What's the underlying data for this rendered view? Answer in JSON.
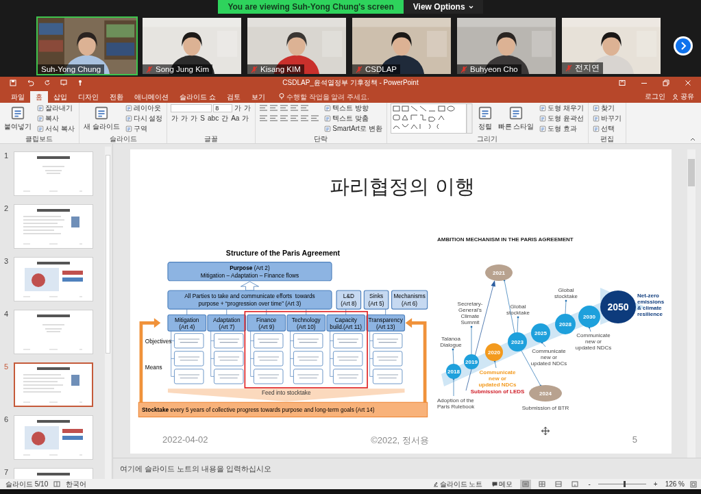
{
  "banner": {
    "text": "You are viewing Suh-Yong Chung's screen",
    "options": "View Options"
  },
  "participants": [
    {
      "name": "Suh-Yong Chung",
      "muted": false,
      "active": true
    },
    {
      "name": "Song Jung Kim",
      "muted": true,
      "active": false
    },
    {
      "name": "Kisang KIM",
      "muted": true,
      "active": false
    },
    {
      "name": "CSDLAP",
      "muted": true,
      "active": false
    },
    {
      "name": "Buhyeon Cho",
      "muted": true,
      "active": false
    },
    {
      "name": "전지연",
      "muted": true,
      "active": false
    }
  ],
  "window": {
    "title": "CSDLAP_윤석열정부 기후정책 - PowerPoint"
  },
  "tabs": [
    {
      "label": "파일",
      "selected": false
    },
    {
      "label": "홈",
      "selected": true
    },
    {
      "label": "삽입",
      "selected": false
    },
    {
      "label": "디자인",
      "selected": false
    },
    {
      "label": "전환",
      "selected": false
    },
    {
      "label": "애니메이션",
      "selected": false
    },
    {
      "label": "슬라이드 쇼",
      "selected": false
    },
    {
      "label": "검토",
      "selected": false
    },
    {
      "label": "보기",
      "selected": false
    }
  ],
  "tell_me": {
    "placeholder": "수행할 작업을 알려 주세요."
  },
  "account": {
    "login": "로그인",
    "share": "공유"
  },
  "ribbon": [
    {
      "label": "클립보드",
      "columns": [
        [
          [
            {
              "kind": "large",
              "label": "붙여넣기"
            }
          ]
        ],
        [
          [
            {
              "kind": "small",
              "label": "잘라내기"
            }
          ],
          [
            {
              "kind": "small",
              "label": "복사"
            }
          ],
          [
            {
              "kind": "small",
              "label": "서식 복사"
            }
          ]
        ]
      ]
    },
    {
      "label": "슬라이드",
      "columns": [
        [
          [
            {
              "kind": "large",
              "label": "새 슬라이드"
            }
          ]
        ],
        [
          [
            {
              "kind": "small",
              "label": "레이아웃"
            }
          ],
          [
            {
              "kind": "small",
              "label": "다시 설정"
            }
          ],
          [
            {
              "kind": "small",
              "label": "구역"
            }
          ]
        ]
      ]
    },
    {
      "label": "글꼴",
      "columns": [
        [
          [
            {
              "kind": "field"
            },
            {
              "kind": "field",
              "value": "8"
            },
            {
              "kind": "glyph",
              "label": "가"
            },
            {
              "kind": "glyph",
              "label": "가"
            }
          ],
          [
            {
              "kind": "glyph",
              "label": "가"
            },
            {
              "kind": "glyph",
              "label": "가"
            },
            {
              "kind": "glyph",
              "label": "가"
            },
            {
              "kind": "glyph",
              "label": "S"
            },
            {
              "kind": "glyph",
              "label": "abc"
            },
            {
              "kind": "glyph",
              "label": "간"
            },
            {
              "kind": "glyph",
              "label": "Aa"
            },
            {
              "kind": "glyph",
              "label": "가"
            }
          ]
        ]
      ]
    },
    {
      "label": "단락",
      "columns": [
        [
          [
            {
              "kind": "icon"
            },
            {
              "kind": "icon"
            },
            {
              "kind": "icon"
            },
            {
              "kind": "icon"
            },
            {
              "kind": "icon"
            }
          ],
          [
            {
              "kind": "icon"
            },
            {
              "kind": "icon"
            },
            {
              "kind": "icon"
            },
            {
              "kind": "icon"
            },
            {
              "kind": "icon"
            },
            {
              "kind": "icon"
            }
          ]
        ],
        [
          [
            {
              "kind": "small",
              "label": "텍스트 방향"
            }
          ],
          [
            {
              "kind": "small",
              "label": "텍스트 맞춤"
            }
          ],
          [
            {
              "kind": "small",
              "label": "SmartArt로 변환"
            }
          ]
        ]
      ]
    },
    {
      "label": "그리기",
      "columns": [
        [
          [
            {
              "kind": "gallery"
            }
          ]
        ],
        [
          [
            {
              "kind": "large",
              "label": "정렬"
            }
          ]
        ],
        [
          [
            {
              "kind": "large",
              "label": "빠른 스타일"
            }
          ]
        ],
        [
          [
            {
              "kind": "small",
              "label": "도형 채우기"
            }
          ],
          [
            {
              "kind": "small",
              "label": "도형 윤곽선"
            }
          ],
          [
            {
              "kind": "small",
              "label": "도형 효과"
            }
          ]
        ]
      ]
    },
    {
      "label": "편집",
      "columns": [
        [
          [
            {
              "kind": "small",
              "label": "찾기"
            }
          ],
          [
            {
              "kind": "small",
              "label": "바꾸기"
            }
          ],
          [
            {
              "kind": "small",
              "label": "선택"
            }
          ]
        ]
      ]
    }
  ],
  "thumbnails": [
    {
      "number": "1",
      "selected": false
    },
    {
      "number": "2",
      "selected": false
    },
    {
      "number": "3",
      "selected": false
    },
    {
      "number": "4",
      "selected": false
    },
    {
      "number": "5",
      "selected": true
    },
    {
      "number": "6",
      "selected": false
    },
    {
      "number": "7",
      "selected": false
    }
  ],
  "slide": {
    "title": "파리협정의 이행",
    "paris": {
      "title": "Structure of the Paris Agreement",
      "purpose": {
        "heading": "Purpose",
        "ref": " (Art 2)",
        "line": "Mitigation – Adaptation – Finance flows"
      },
      "parties": [
        "All Parties to take and communicate efforts  towards",
        "purpose + “progression over time” (Art 3)"
      ],
      "side_boxes": [
        {
          "name": "L&D",
          "ref": "(Art 8)"
        },
        {
          "name": "Sinks",
          "ref": "(Art 5)"
        },
        {
          "name": "Mechanisms",
          "ref": "(Art 6)"
        }
      ],
      "columns": [
        {
          "name": "Mitigation",
          "ref": "(Art 4)",
          "highlighted": false
        },
        {
          "name": "Adaptation",
          "ref": "(Art 7)",
          "highlighted": false
        },
        {
          "name": "Finance",
          "ref": "(Art 9)",
          "highlighted": true
        },
        {
          "name": "Technology",
          "ref": "(Art 10)",
          "highlighted": true
        },
        {
          "name": "Capacity",
          "ref": "build.(Art 11)",
          "highlighted": true
        },
        {
          "name": "Transparency",
          "ref": "(Art 13)",
          "highlighted": false
        }
      ],
      "row_labels": [
        "Objectives",
        "Means"
      ],
      "feed": "Feed into stocktake",
      "stocktake": {
        "heading": "Stocktake",
        "text": " every 5 years of collective progress towards purpose and long-term goals (Art 14)"
      }
    },
    "ambition": {
      "title": "AMBITION MECHANISM IN THE PARIS AGREEMENT",
      "milestones": [
        {
          "year": "2018",
          "kind": "cycle"
        },
        {
          "year": "2019",
          "kind": "cycle"
        },
        {
          "year": "2020",
          "kind": "ndc"
        },
        {
          "year": "2021",
          "kind": "event"
        },
        {
          "year": "2023",
          "kind": "cycle"
        },
        {
          "year": "2024",
          "kind": "event"
        },
        {
          "year": "2025",
          "kind": "cycle"
        },
        {
          "year": "2028",
          "kind": "cycle"
        },
        {
          "year": "2030",
          "kind": "cycle"
        },
        {
          "year": "2050",
          "kind": "goal"
        }
      ],
      "labels": [
        {
          "kind": "note",
          "lines": [
            "Talanoa",
            "Dialogue"
          ]
        },
        {
          "kind": "note",
          "lines": [
            "Secretary-",
            "General's",
            "Climate",
            "Summit"
          ]
        },
        {
          "kind": "note",
          "lines": [
            "Global",
            "stocktake"
          ]
        },
        {
          "kind": "note",
          "lines": [
            "Global",
            "stocktake"
          ]
        },
        {
          "kind": "ndc",
          "lines": [
            "Communicate",
            "new or",
            "updated NDCs"
          ]
        },
        {
          "kind": "leds",
          "lines": [
            "Submission of LEDS"
          ]
        },
        {
          "kind": "note",
          "lines": [
            "Adoption of the",
            "Paris Rulebook"
          ]
        },
        {
          "kind": "note",
          "lines": [
            "Communicate",
            "new or",
            "updated NDCs"
          ]
        },
        {
          "kind": "note",
          "lines": [
            "Submission of BTR"
          ]
        },
        {
          "kind": "note",
          "lines": [
            "Communicate",
            "new or",
            "updated NDCs"
          ]
        },
        {
          "kind": "goal",
          "lines": [
            "Net-zero",
            "emissions",
            "& climate",
            "resilience"
          ]
        }
      ]
    },
    "footer": {
      "date": "2022-04-02",
      "copyright": "©2022, 정서용",
      "number": "5"
    }
  },
  "notes": {
    "placeholder": "여기에 슬라이드 노트의 내용을 입력하십시오"
  },
  "status_bar": {
    "slide": "슬라이드 5/10",
    "language": "한국어",
    "notes": "슬라이드 노트",
    "comments": "메모",
    "views": [
      {
        "selected": true
      },
      {
        "selected": false
      },
      {
        "selected": false
      },
      {
        "selected": false
      }
    ],
    "zoom_out": "-",
    "zoom_in": "+",
    "zoom": {
      "level": 0.56,
      "reading": "126 %"
    }
  }
}
